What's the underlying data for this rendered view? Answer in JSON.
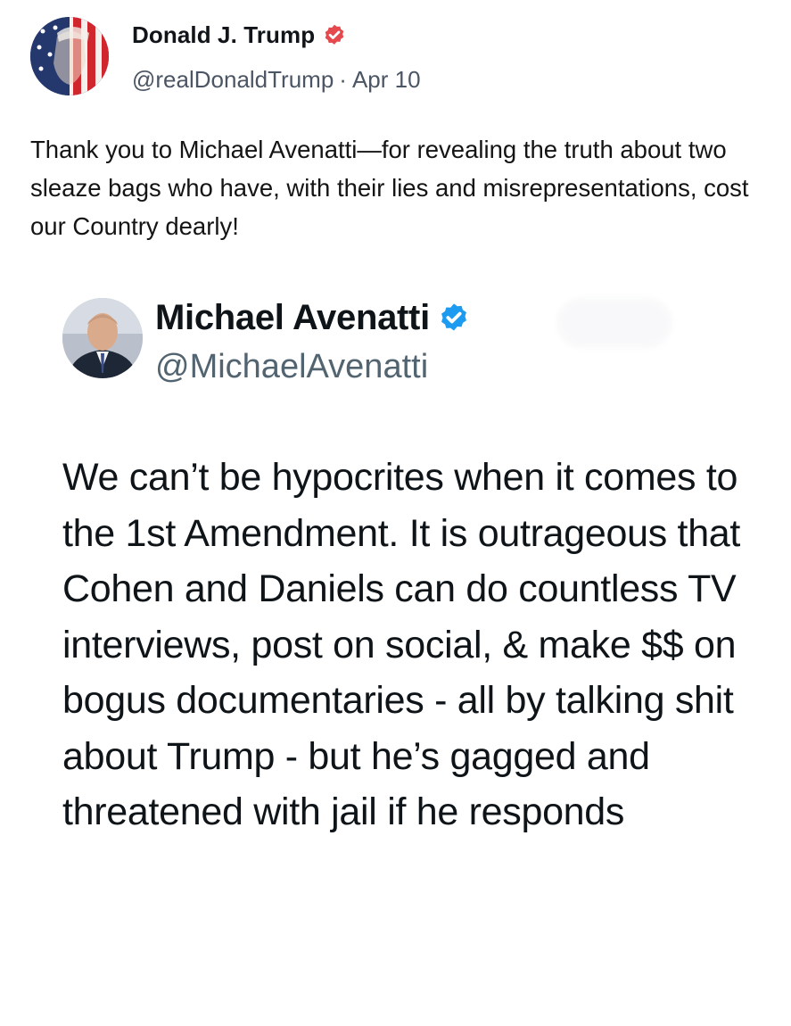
{
  "post": {
    "author_name": "Donald J. Trump",
    "handle": "@realDonaldTrump",
    "separator": "·",
    "date": "Apr 10",
    "text": "Thank you to Michael Avenatti—for revealing the truth about two sleaze bags who have, with their lies and misrepresentations, cost our Country dearly!",
    "verified_color": "#e5494d"
  },
  "embedded_tweet": {
    "author_name": "Michael Avenatti",
    "handle": "@MichaelAvenatti",
    "text": "We can’t be hypocrites when it comes to the 1st Amendment. It is outrageous that Cohen and Daniels can do countless TV interviews, post on social, & make $$ on bogus documentaries - all by talking shit about Trump - but he’s gagged and threatened with jail if he responds",
    "verified_color": "#1d9bf0"
  },
  "icons": {
    "trump_verified": "verified-badge-icon",
    "avenatti_verified": "verified-badge-icon"
  }
}
